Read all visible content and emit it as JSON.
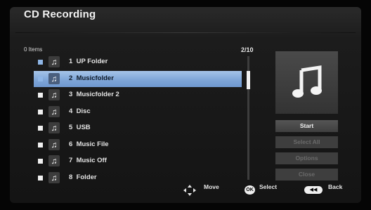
{
  "header": {
    "title": "CD Recording"
  },
  "list": {
    "count_label": "0 Items",
    "page_indicator": "2/10",
    "items": [
      {
        "number": "1",
        "name": "UP Folder",
        "checked": false,
        "selected": false
      },
      {
        "number": "2",
        "name": "Musicfolder",
        "checked": false,
        "selected": true
      },
      {
        "number": "3",
        "name": "Musicfolder 2",
        "checked": false,
        "selected": false
      },
      {
        "number": "4",
        "name": "Disc",
        "checked": false,
        "selected": false
      },
      {
        "number": "5",
        "name": "USB",
        "checked": false,
        "selected": false
      },
      {
        "number": "6",
        "name": "Music File",
        "checked": false,
        "selected": false
      },
      {
        "number": "7",
        "name": "Music Off",
        "checked": false,
        "selected": false
      },
      {
        "number": "8",
        "name": "Folder",
        "checked": false,
        "selected": false
      }
    ]
  },
  "side_panel": {
    "preview_icon": "music-note-icon",
    "buttons": [
      {
        "label": "Start",
        "enabled": true
      },
      {
        "label": "Select All",
        "enabled": false
      },
      {
        "label": "Options",
        "enabled": false
      },
      {
        "label": "Close",
        "enabled": false
      }
    ]
  },
  "legend": {
    "move_label": "Move",
    "select_icon_text": "OK",
    "select_label": "Select",
    "back_label": "Back"
  },
  "colors": {
    "selection": "#7fa6d8",
    "background": "#141414"
  }
}
